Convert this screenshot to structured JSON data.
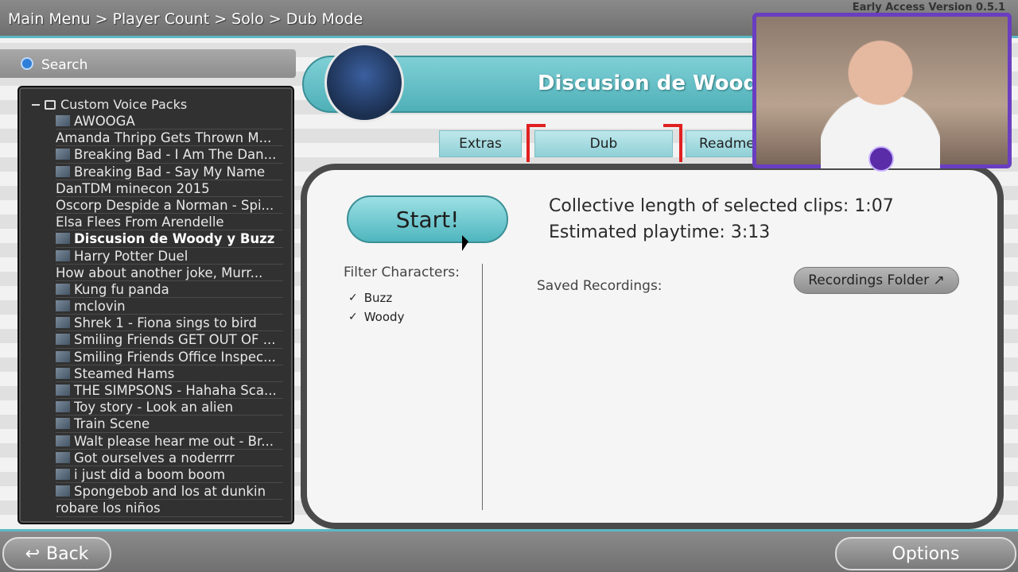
{
  "topbar": {
    "breadcrumb": "Main Menu > Player Count > Solo > Dub Mode",
    "version": "Early Access Version 0.5.1"
  },
  "search": {
    "label": "Search"
  },
  "tree": {
    "root_label": "Custom Voice Packs",
    "items": [
      {
        "label": "AWOOGA",
        "thumb": true
      },
      {
        "label": "Amanda Thripp Gets Thrown M...",
        "thumb": false
      },
      {
        "label": "Breaking Bad - I Am The Dan...",
        "thumb": true
      },
      {
        "label": "Breaking Bad - Say My Name",
        "thumb": true
      },
      {
        "label": "DanTDM minecon 2015",
        "thumb": false
      },
      {
        "label": "Oscorp Despide a Norman - Spi...",
        "thumb": false
      },
      {
        "label": "Elsa Flees From Arendelle",
        "thumb": false
      },
      {
        "label": "Discusion de Woody y Buzz",
        "thumb": true,
        "selected": true
      },
      {
        "label": "Harry Potter Duel",
        "thumb": true
      },
      {
        "label": "How about another joke, Murr...",
        "thumb": false
      },
      {
        "label": "Kung fu panda",
        "thumb": true
      },
      {
        "label": "mclovin",
        "thumb": true
      },
      {
        "label": "Shrek 1 -  Fiona sings to bird",
        "thumb": true
      },
      {
        "label": "Smiling Friends GET OUT OF ...",
        "thumb": true
      },
      {
        "label": "Smiling Friends Office Inspec...",
        "thumb": true
      },
      {
        "label": "Steamed Hams",
        "thumb": true
      },
      {
        "label": "THE SIMPSONS - Hahaha Sca...",
        "thumb": true
      },
      {
        "label": "Toy story - Look an alien",
        "thumb": true
      },
      {
        "label": "Train Scene",
        "thumb": true
      },
      {
        "label": "Walt please hear me out - Br...",
        "thumb": true
      },
      {
        "label": "Got ourselves a noderrrr",
        "thumb": true
      },
      {
        "label": "i just did a boom boom",
        "thumb": true
      },
      {
        "label": "Spongebob and los at dunkin",
        "thumb": true
      },
      {
        "label": "robare los niños",
        "thumb": false
      }
    ]
  },
  "header": {
    "title": "Discusion de Woody"
  },
  "tabs": {
    "extras": "Extras",
    "dub": "Dub",
    "readme": "Readme"
  },
  "main": {
    "start_label": "Start!",
    "collective_length": "Collective length of selected clips:  1:07",
    "estimated_playtime": "Estimated playtime:  3:13",
    "filter_title": "Filter Characters:",
    "filters": [
      {
        "label": "Buzz",
        "checked": true
      },
      {
        "label": "Woody",
        "checked": true
      }
    ],
    "saved_recordings_label": "Saved Recordings:",
    "recordings_folder_label": "Recordings Folder ↗"
  },
  "footer": {
    "back_label": "Back",
    "back_icon": "↩",
    "options_label": "Options"
  },
  "colors": {
    "accent": "#5ab9c4",
    "tab": "#8fd0d6",
    "selection_bracket": "#e02020",
    "webcam_border": "#6a3ec0"
  }
}
